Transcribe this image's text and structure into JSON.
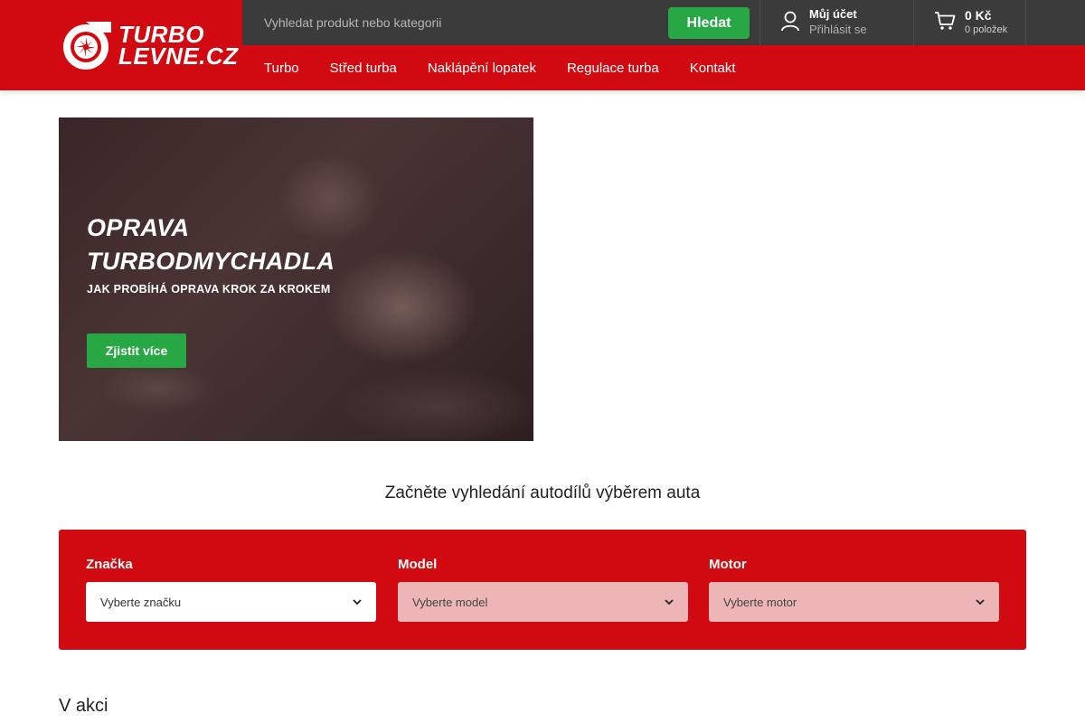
{
  "brand": {
    "line1": "TURBO",
    "line2": "LEVNE.CZ"
  },
  "search": {
    "placeholder": "Vyhledat produkt nebo kategorii",
    "button_label": "Hledat"
  },
  "account": {
    "title": "Můj účet",
    "subtitle": "Přihlásit se"
  },
  "cart": {
    "price": "0 Kč",
    "count": "0 položek"
  },
  "nav": {
    "items": [
      {
        "label": "Turbo"
      },
      {
        "label": "Střed turba"
      },
      {
        "label": "Naklápění lopatek"
      },
      {
        "label": "Regulace turba"
      },
      {
        "label": "Kontakt"
      }
    ]
  },
  "banner": {
    "title_line1": "OPRAVA",
    "title_line2": "TURBODMYCHADLA",
    "subtitle": "JAK PROBÍHÁ OPRAVA KROK ZA KROKEM",
    "button_label": "Zjistit více"
  },
  "selector": {
    "heading": "Začněte vyhledání autodílů výběrem auta",
    "brand_label": "Značka",
    "brand_value": "Vyberte značku",
    "model_label": "Model",
    "model_value": "Vyberte model",
    "engine_label": "Motor",
    "engine_value": "Vyberte motor"
  },
  "sale": {
    "heading": "V akci"
  },
  "colors": {
    "brand_red": "#d10a11",
    "topbar": "#3b3b3b",
    "accent_green": "#28a745"
  }
}
